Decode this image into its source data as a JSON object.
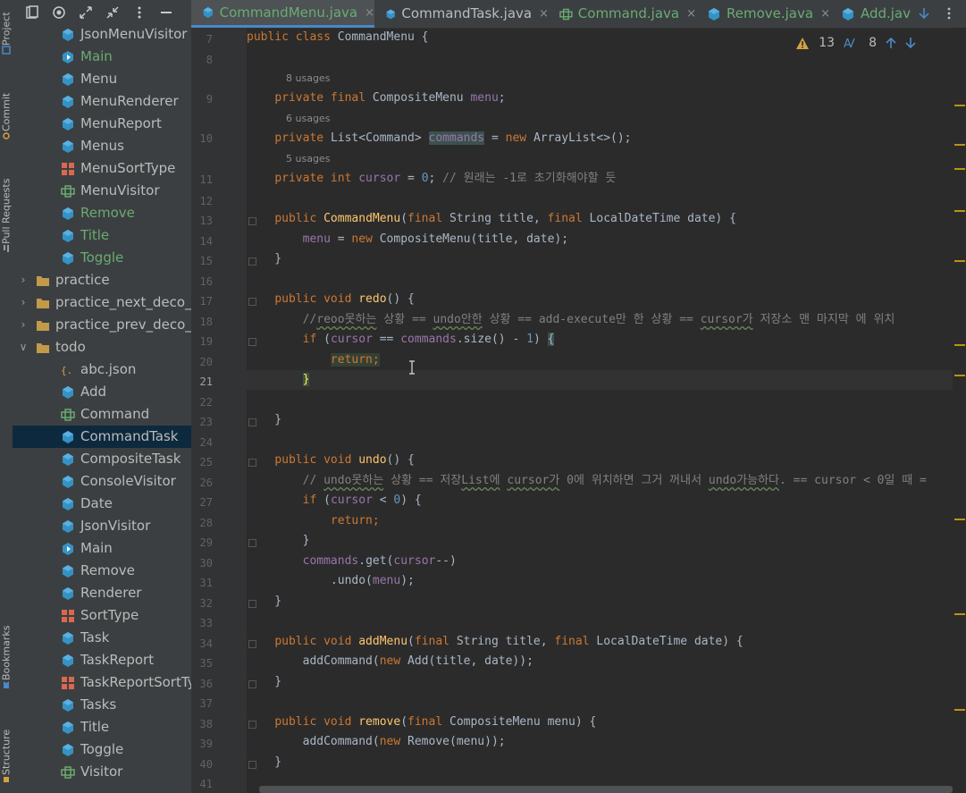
{
  "left_stripe": {
    "project_label": "Project",
    "commit_label": "Commit",
    "pull_requests_label": "Pull Requests",
    "bookmarks_label": "Bookmarks",
    "structure_label": "Structure"
  },
  "project_tree": {
    "items": [
      {
        "label": "JsonMenuVisitor",
        "icon": "class-icon",
        "color": "#bbbbbb"
      },
      {
        "label": "Main",
        "icon": "main-class-icon",
        "color": "#6aab73"
      },
      {
        "label": "Menu",
        "icon": "class-icon",
        "color": "#bbbbbb"
      },
      {
        "label": "MenuRenderer",
        "icon": "class-icon",
        "color": "#bbbbbb"
      },
      {
        "label": "MenuReport",
        "icon": "class-icon",
        "color": "#bbbbbb"
      },
      {
        "label": "Menus",
        "icon": "class-icon",
        "color": "#bbbbbb"
      },
      {
        "label": "MenuSortType",
        "icon": "enum-icon",
        "color": "#bbbbbb"
      },
      {
        "label": "MenuVisitor",
        "icon": "interface-icon",
        "color": "#bbbbbb"
      },
      {
        "label": "Remove",
        "icon": "class-icon",
        "color": "#6aab73"
      },
      {
        "label": "Title",
        "icon": "class-icon",
        "color": "#6aab73"
      },
      {
        "label": "Toggle",
        "icon": "class-icon",
        "color": "#6aab73"
      },
      {
        "label": "practice",
        "icon": "folder-icon",
        "color": "#bbbbbb"
      },
      {
        "label": "practice_next_deco_fo",
        "icon": "folder-icon",
        "color": "#bbbbbb"
      },
      {
        "label": "practice_prev_deco_fo",
        "icon": "folder-icon",
        "color": "#bbbbbb"
      },
      {
        "label": "todo",
        "icon": "folder-icon",
        "color": "#bbbbbb"
      },
      {
        "label": "abc.json",
        "icon": "json-icon",
        "color": "#bbbbbb"
      },
      {
        "label": "Add",
        "icon": "class-icon",
        "color": "#bbbbbb"
      },
      {
        "label": "Command",
        "icon": "interface-icon",
        "color": "#bbbbbb"
      },
      {
        "label": "CommandTask",
        "icon": "class-icon",
        "color": "#bbbbbb"
      },
      {
        "label": "CompositeTask",
        "icon": "class-icon",
        "color": "#bbbbbb"
      },
      {
        "label": "ConsoleVisitor",
        "icon": "class-icon",
        "color": "#bbbbbb"
      },
      {
        "label": "Date",
        "icon": "class-icon",
        "color": "#bbbbbb"
      },
      {
        "label": "JsonVisitor",
        "icon": "class-icon",
        "color": "#bbbbbb"
      },
      {
        "label": "Main",
        "icon": "main-class-icon",
        "color": "#bbbbbb"
      },
      {
        "label": "Remove",
        "icon": "class-icon",
        "color": "#bbbbbb"
      },
      {
        "label": "Renderer",
        "icon": "class-icon",
        "color": "#bbbbbb"
      },
      {
        "label": "SortType",
        "icon": "enum-icon",
        "color": "#bbbbbb"
      },
      {
        "label": "Task",
        "icon": "class-icon",
        "color": "#bbbbbb"
      },
      {
        "label": "TaskReport",
        "icon": "class-icon",
        "color": "#bbbbbb"
      },
      {
        "label": "TaskReportSortTyp",
        "icon": "enum-icon",
        "color": "#bbbbbb"
      },
      {
        "label": "Tasks",
        "icon": "class-icon",
        "color": "#bbbbbb"
      },
      {
        "label": "Title",
        "icon": "class-icon",
        "color": "#bbbbbb"
      },
      {
        "label": "Toggle",
        "icon": "class-icon",
        "color": "#bbbbbb"
      },
      {
        "label": "Visitor",
        "icon": "interface-icon",
        "color": "#bbbbbb"
      }
    ],
    "selected": "CommandTask"
  },
  "tabs": [
    {
      "label": "CommandMenu.java",
      "icon": "class-icon",
      "close": "×",
      "color": "#6aab73",
      "active": true
    },
    {
      "label": "CommandTask.java",
      "icon": "class-icon",
      "close": "×",
      "color": "#bbbbbb"
    },
    {
      "label": "Command.java",
      "icon": "interface-icon",
      "close": "×",
      "color": "#6aab73"
    },
    {
      "label": "Remove.java",
      "icon": "class-icon",
      "close": "×",
      "color": "#6aab73"
    },
    {
      "label": "Add.jav",
      "icon": "class-icon",
      "close": "",
      "color": "#6aab73"
    }
  ],
  "inspection": {
    "warnings": "13",
    "typos": "8"
  },
  "editor": {
    "usage_hints": {
      "menu": "8 usages",
      "commands": "6 usages",
      "cursor": "5 usages"
    },
    "line_numbers": [
      "7",
      "8",
      "9",
      "10",
      "11",
      "12",
      "13",
      "14",
      "15",
      "16",
      "17",
      "18",
      "19",
      "20",
      "21",
      "22",
      "23",
      "24",
      "25",
      "26",
      "27",
      "28",
      "29",
      "30",
      "31",
      "32",
      "33",
      "34",
      "35",
      "36",
      "37",
      "38",
      "39",
      "40",
      "41"
    ],
    "current_line": "21"
  },
  "colors": {
    "keyword": "#cc7832",
    "field": "#9876aa",
    "number": "#6897bb",
    "comment": "#808080",
    "method": "#ffc66d",
    "accent": "#4a88c7",
    "modified": "#6aab73"
  }
}
